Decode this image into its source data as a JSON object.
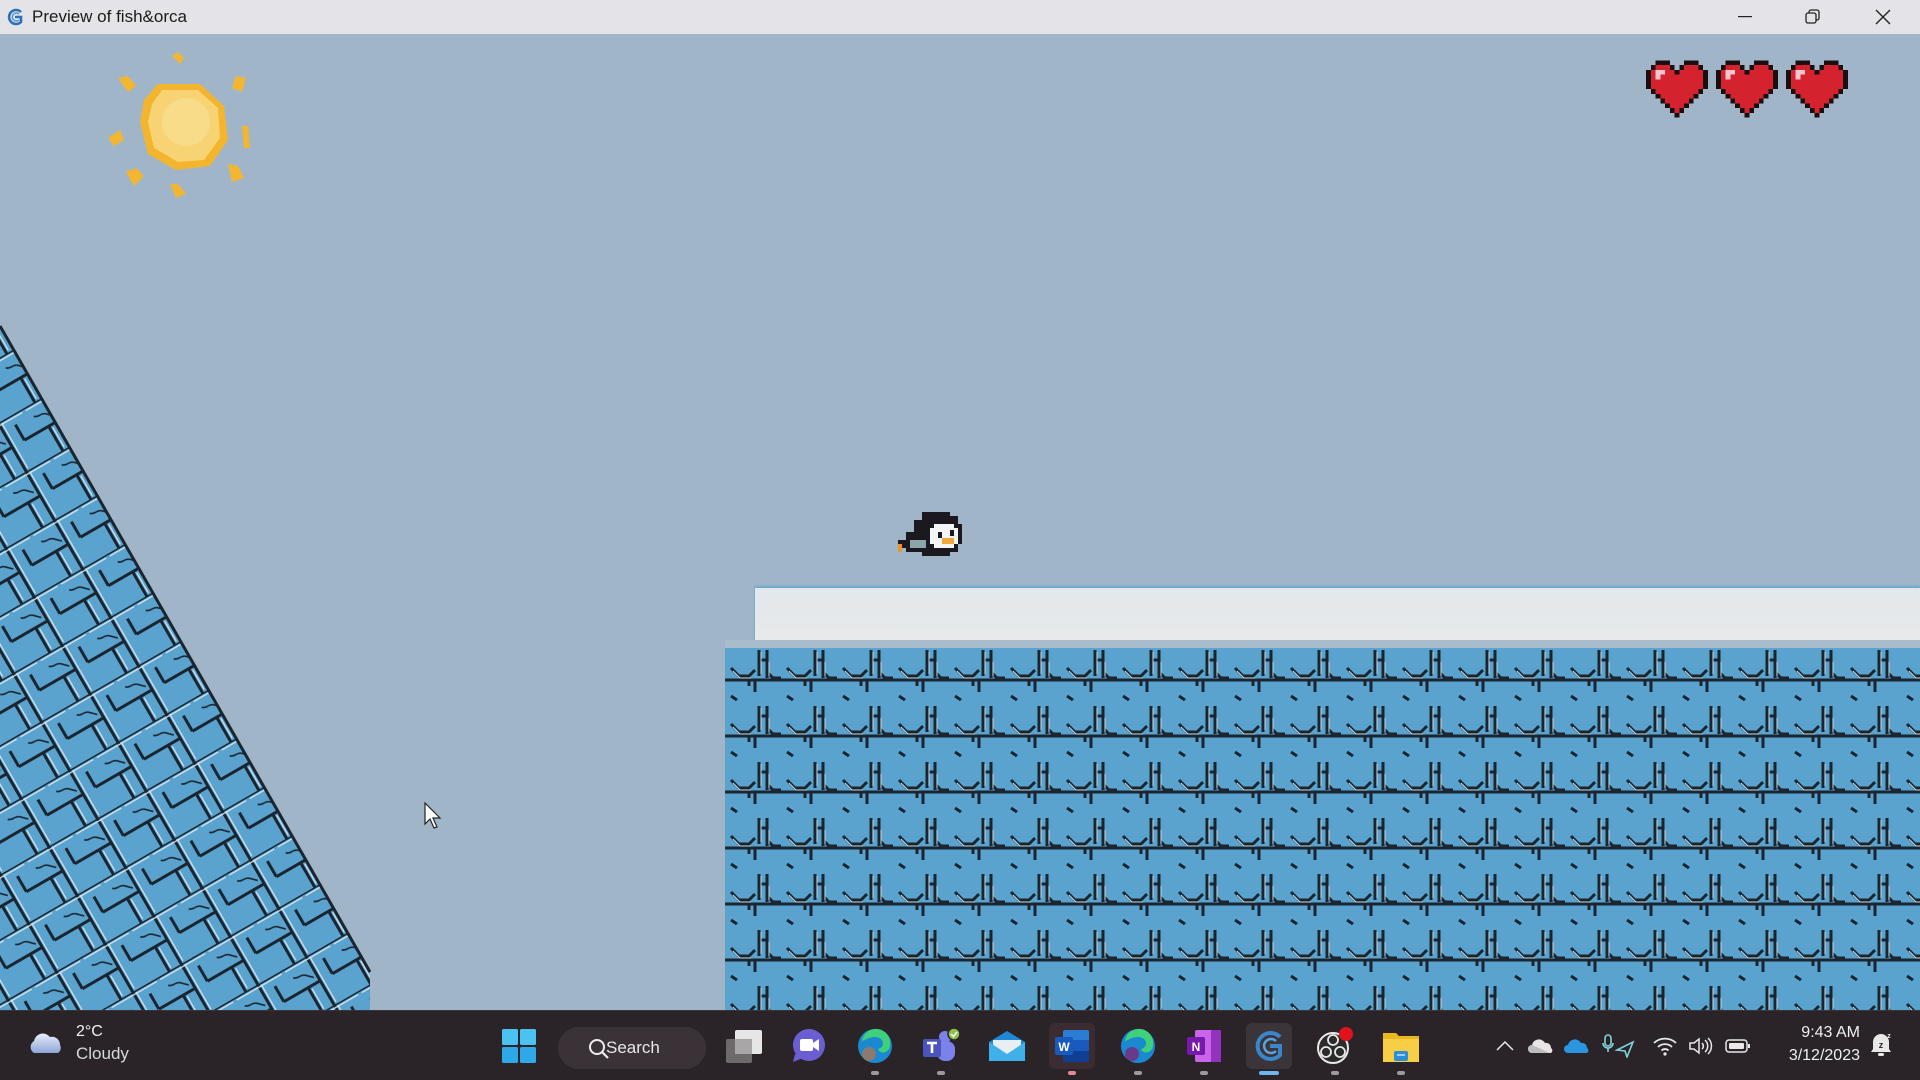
{
  "window": {
    "title": "Preview of fish&orca",
    "app_icon": "gdevelop-icon",
    "controls": [
      "minimize",
      "restore",
      "close"
    ]
  },
  "game": {
    "lives": 3,
    "max_lives": 3,
    "sky_color": "#a0b6c8",
    "tile_color": "#5ba3cf",
    "sprites": [
      "sun",
      "penguin-player",
      "ice-ramp",
      "snow-platform",
      "ice-block-wall",
      "heart-life"
    ]
  },
  "taskbar": {
    "weather": {
      "temp": "2°C",
      "condition": "Cloudy",
      "icon": "cloud-icon"
    },
    "search_label": "Search",
    "apps": [
      {
        "name": "start",
        "icon": "windows-start-icon"
      },
      {
        "name": "task-view",
        "icon": "task-view-icon"
      },
      {
        "name": "teams-meet",
        "icon": "video-chat-icon"
      },
      {
        "name": "edge-profile",
        "icon": "edge-icon"
      },
      {
        "name": "teams",
        "icon": "teams-icon"
      },
      {
        "name": "mail",
        "icon": "mail-icon"
      },
      {
        "name": "word",
        "icon": "word-icon"
      },
      {
        "name": "edge-beta",
        "icon": "edge-icon"
      },
      {
        "name": "onenote",
        "icon": "onenote-icon"
      },
      {
        "name": "gdevelop",
        "icon": "gdevelop-icon"
      },
      {
        "name": "obs",
        "icon": "obs-icon"
      },
      {
        "name": "file-explorer",
        "icon": "folder-icon"
      }
    ],
    "tray": {
      "icons": [
        "chevron-up-icon",
        "onedrive-personal-icon",
        "onedrive-business-icon",
        "mic-location-icon",
        "wifi-icon",
        "volume-icon",
        "battery-icon"
      ],
      "time": "9:43 AM",
      "date": "3/12/2023",
      "notifications_icon": "bell-snooze-icon"
    }
  }
}
